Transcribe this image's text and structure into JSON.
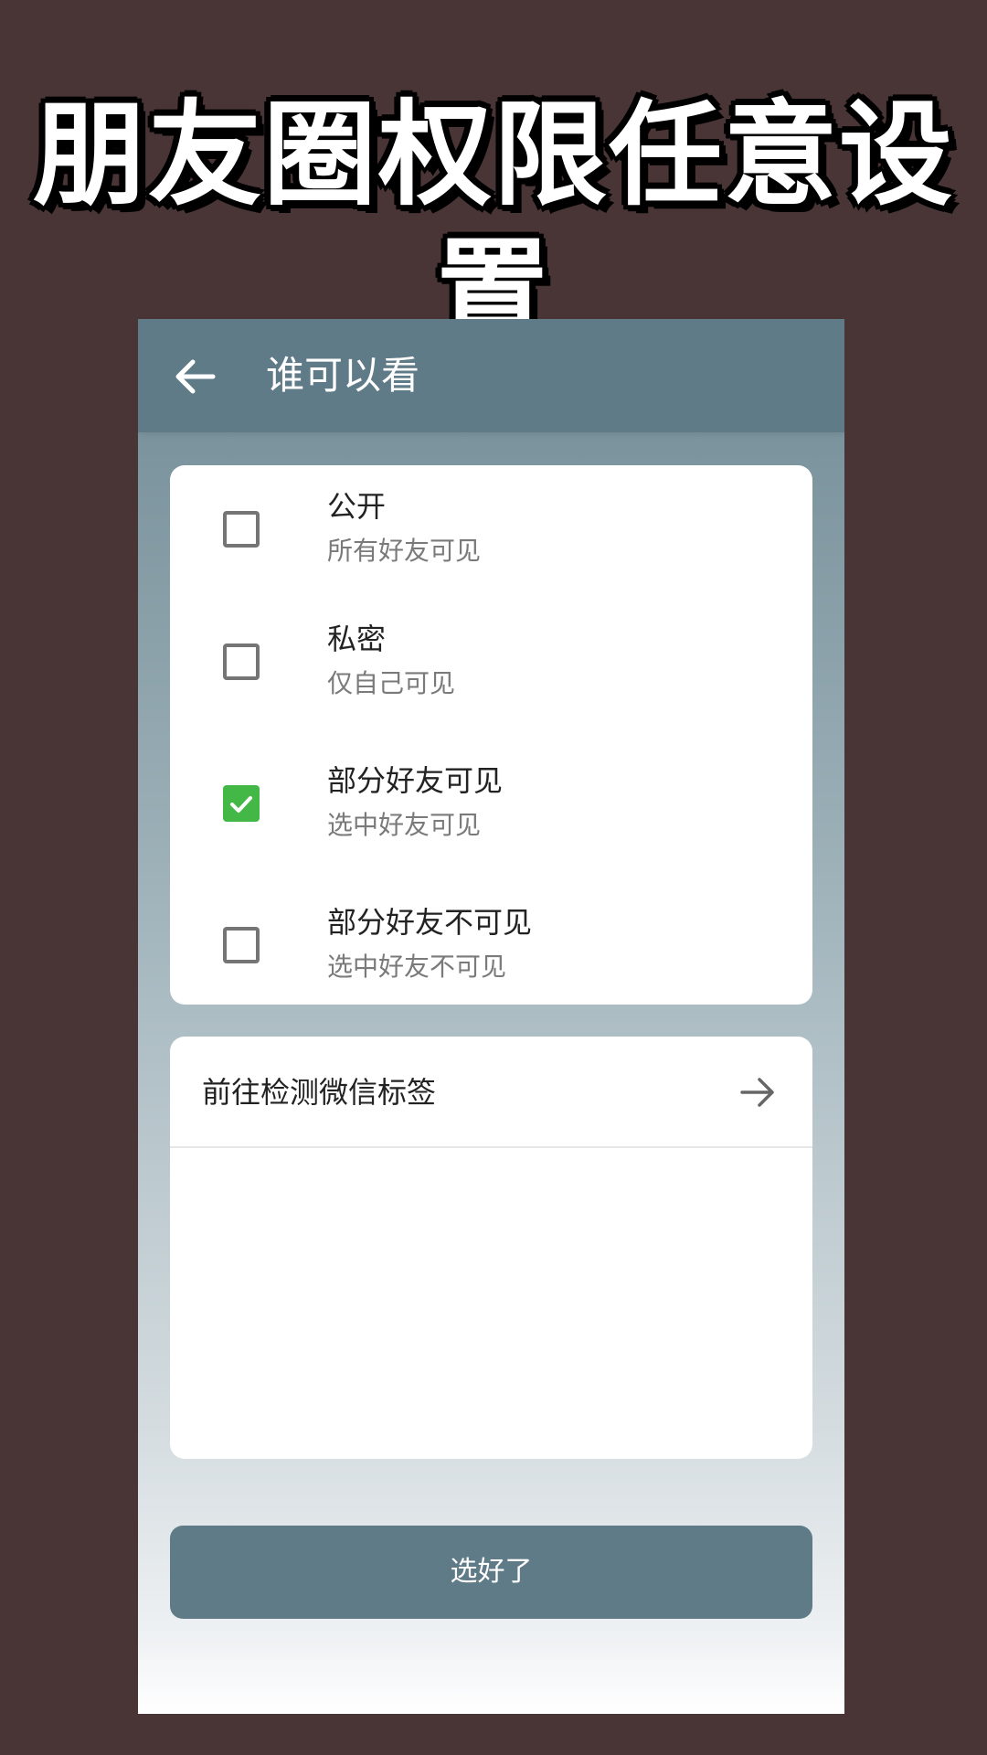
{
  "promo": {
    "title": "朋友圈权限任意设置"
  },
  "app_bar": {
    "title": "谁可以看",
    "back_icon": "arrow-left-icon"
  },
  "options": [
    {
      "title": "公开",
      "subtitle": "所有好友可见",
      "checked": false
    },
    {
      "title": "私密",
      "subtitle": "仅自己可见",
      "checked": false
    },
    {
      "title": "部分好友可见",
      "subtitle": "选中好友可见",
      "checked": true
    },
    {
      "title": "部分好友不可见",
      "subtitle": "选中好友不可见",
      "checked": false
    }
  ],
  "tag_row": {
    "label": "前往检测微信标签",
    "icon": "arrow-right-icon"
  },
  "confirm_button": {
    "label": "选好了"
  },
  "colors": {
    "background": "#4a3536",
    "primary": "#607b88",
    "check_green": "#44b846",
    "card": "#ffffff"
  }
}
